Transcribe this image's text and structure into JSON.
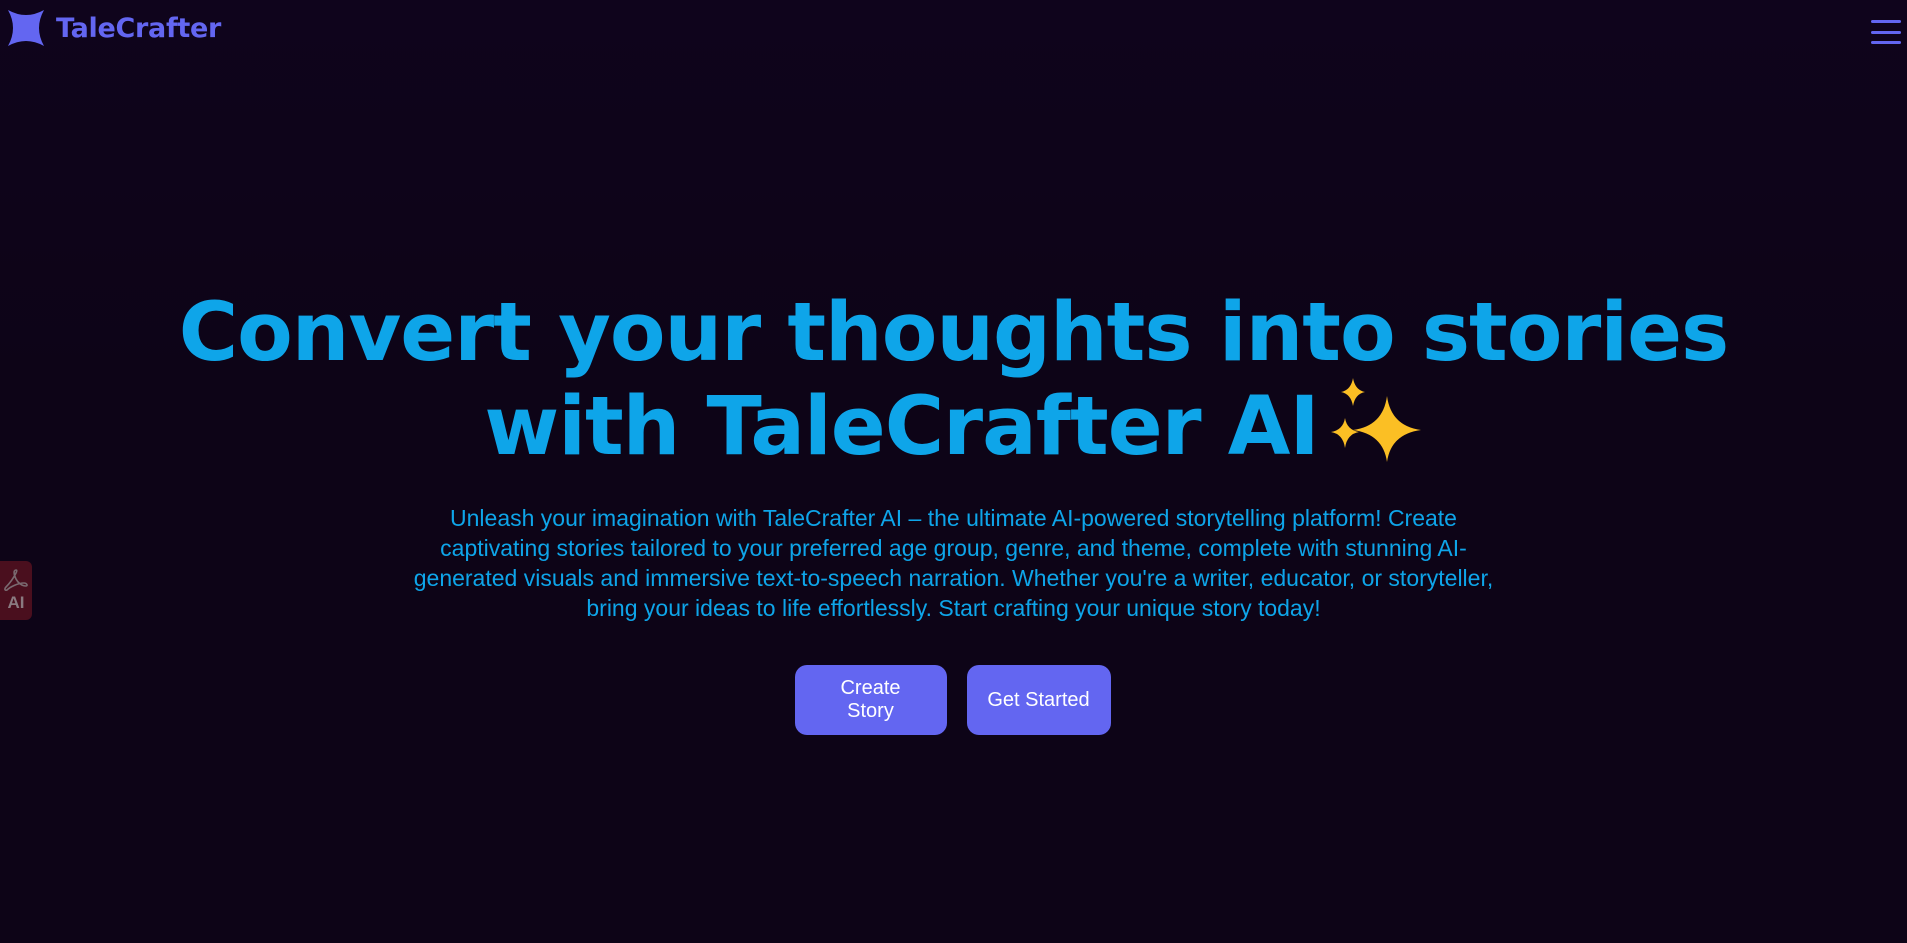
{
  "header": {
    "brand_name": "TaleCrafter",
    "logo_icon": "four-point-star-logo-icon",
    "menu_icon": "hamburger-menu-icon"
  },
  "hero": {
    "headline_line1": "Convert your thoughts into stories",
    "headline_line2": "with TaleCrafter AI",
    "headline_emoji_icon": "sparkles-icon",
    "description": "Unleash your imagination with TaleCrafter AI – the ultimate AI-powered storytelling platform! Create captivating stories tailored to your preferred age group, genre, and theme, complete with stunning AI-generated visuals and immersive text-to-speech narration. Whether you're a writer, educator, or storyteller, bring your ideas to life effortlessly. Start crafting your unique story today!"
  },
  "actions": {
    "create_story_label": "Create Story",
    "get_started_label": "Get Started"
  },
  "side_widget": {
    "icon": "acrobat-pdf-icon",
    "label": "AI"
  },
  "colors": {
    "background": "#0d0417",
    "accent": "#6366f1",
    "headline": "#0ea5e9",
    "button_text": "#ffffff",
    "sparkle": "#fbbf24"
  }
}
